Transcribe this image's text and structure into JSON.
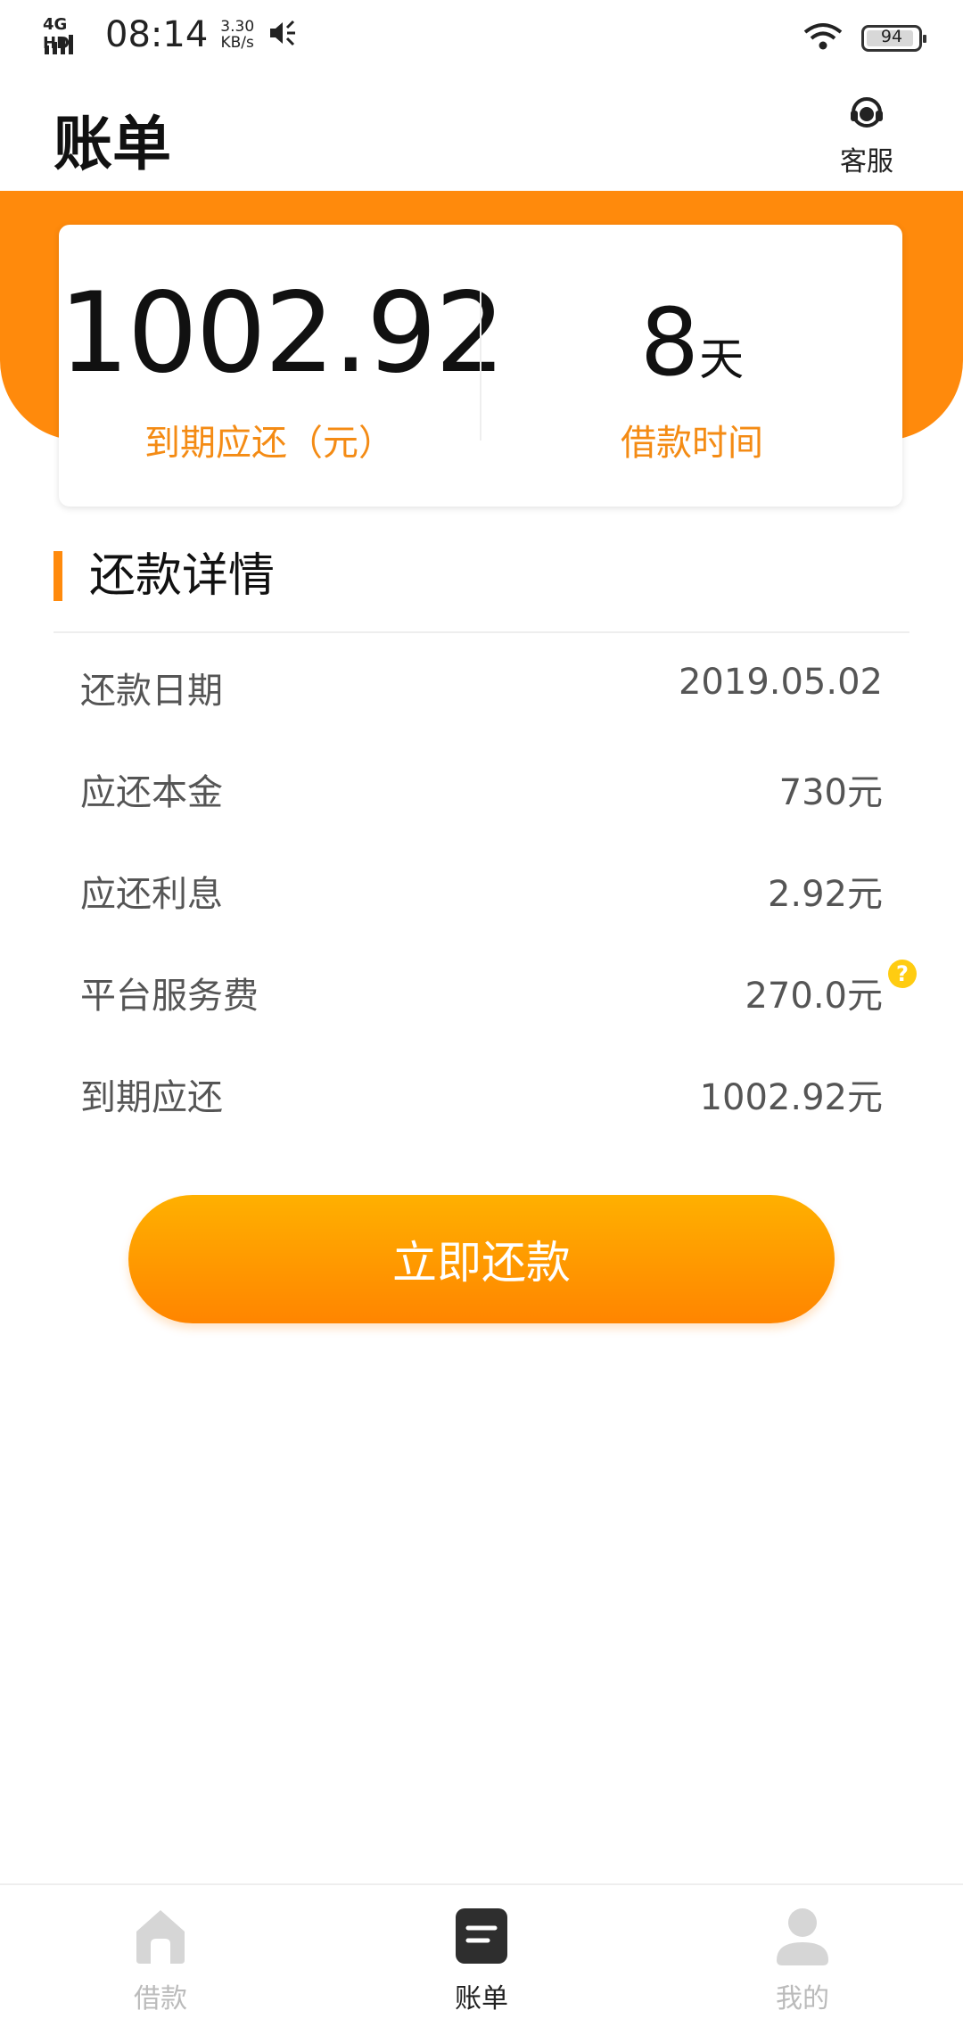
{
  "status_bar": {
    "network": "4G HD",
    "time": "08:14",
    "speed_value": "3.30",
    "speed_unit": "KB/s",
    "battery": "94"
  },
  "header": {
    "title": "账单",
    "customer_service_label": "客服"
  },
  "summary": {
    "amount": "1002.92",
    "amount_label": "到期应还（元）",
    "days_value": "8",
    "days_unit": "天",
    "days_label": "借款时间"
  },
  "details": {
    "title": "还款详情",
    "rows": [
      {
        "label": "还款日期",
        "value": "2019.05.02"
      },
      {
        "label": "应还本金",
        "value": "730元"
      },
      {
        "label": "应还利息",
        "value": "2.92元"
      },
      {
        "label": "平台服务费",
        "value": "270.0元"
      },
      {
        "label": "到期应还",
        "value": "1002.92元"
      }
    ],
    "help_mark": "?"
  },
  "action": {
    "repay_label": "立即还款"
  },
  "bottom_nav": {
    "items": [
      {
        "label": "借款",
        "icon": "home-icon"
      },
      {
        "label": "账单",
        "icon": "bill-icon"
      },
      {
        "label": "我的",
        "icon": "user-icon"
      }
    ],
    "active_index": 1
  },
  "colors": {
    "accent": "#ff8a0c",
    "accent_text": "#f48b14",
    "help": "#ffcc11"
  }
}
